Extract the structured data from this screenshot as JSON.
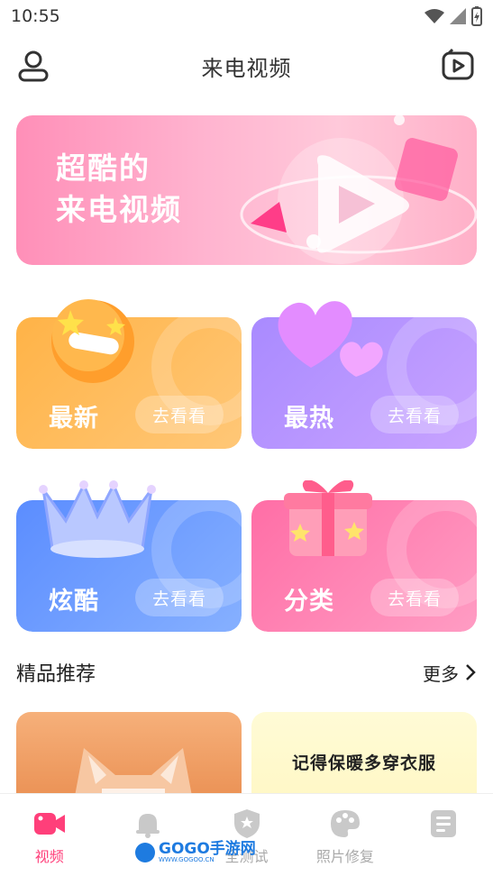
{
  "status": {
    "time": "10:55"
  },
  "header": {
    "title": "来电视频"
  },
  "banner": {
    "line1": "超酷的",
    "line2": "来电视频"
  },
  "cards": [
    {
      "label": "最新",
      "action": "去看看"
    },
    {
      "label": "最热",
      "action": "去看看"
    },
    {
      "label": "炫酷",
      "action": "去看看"
    },
    {
      "label": "分类",
      "action": "去看看"
    }
  ],
  "recommend": {
    "title": "精品推荐",
    "more": "更多",
    "card2_text": "记得保暖多穿衣服"
  },
  "tabs": [
    {
      "label": "视频",
      "icon": "video-icon"
    },
    {
      "label": "",
      "icon": "bell-icon"
    },
    {
      "label": "全测试",
      "icon": "shield-star-icon"
    },
    {
      "label": "照片修复",
      "icon": "palette-icon"
    },
    {
      "label": "",
      "icon": "list-icon"
    }
  ],
  "watermark": {
    "text": "GOGO手游网",
    "sub": "WWW.GOGOO.CN"
  },
  "colors": {
    "accent": "#ff3f7a",
    "orange": "#ffa94a",
    "purple": "#b48cff",
    "blue": "#6fa2ff",
    "pink": "#ff7fb0"
  }
}
